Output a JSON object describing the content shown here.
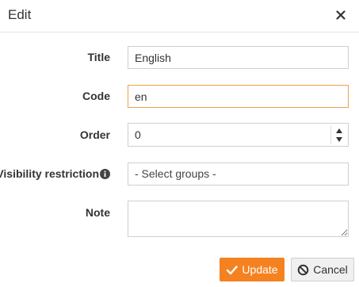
{
  "dialog": {
    "title": "Edit",
    "close_icon": "close-icon"
  },
  "form": {
    "title": {
      "label": "Title",
      "value": "English"
    },
    "code": {
      "label": "Code",
      "value": "en"
    },
    "order": {
      "label": "Order",
      "value": "0"
    },
    "visibility": {
      "label": "Visibility restriction",
      "icon": "info-icon",
      "selected": "- Select groups -"
    },
    "note": {
      "label": "Note",
      "value": ""
    }
  },
  "buttons": {
    "update_label": "Update",
    "update_icon": "checkmark-icon",
    "cancel_label": "Cancel",
    "cancel_icon": "ban-icon"
  },
  "colors": {
    "accent": "#f58220",
    "focus_border": "#f0a04b"
  }
}
